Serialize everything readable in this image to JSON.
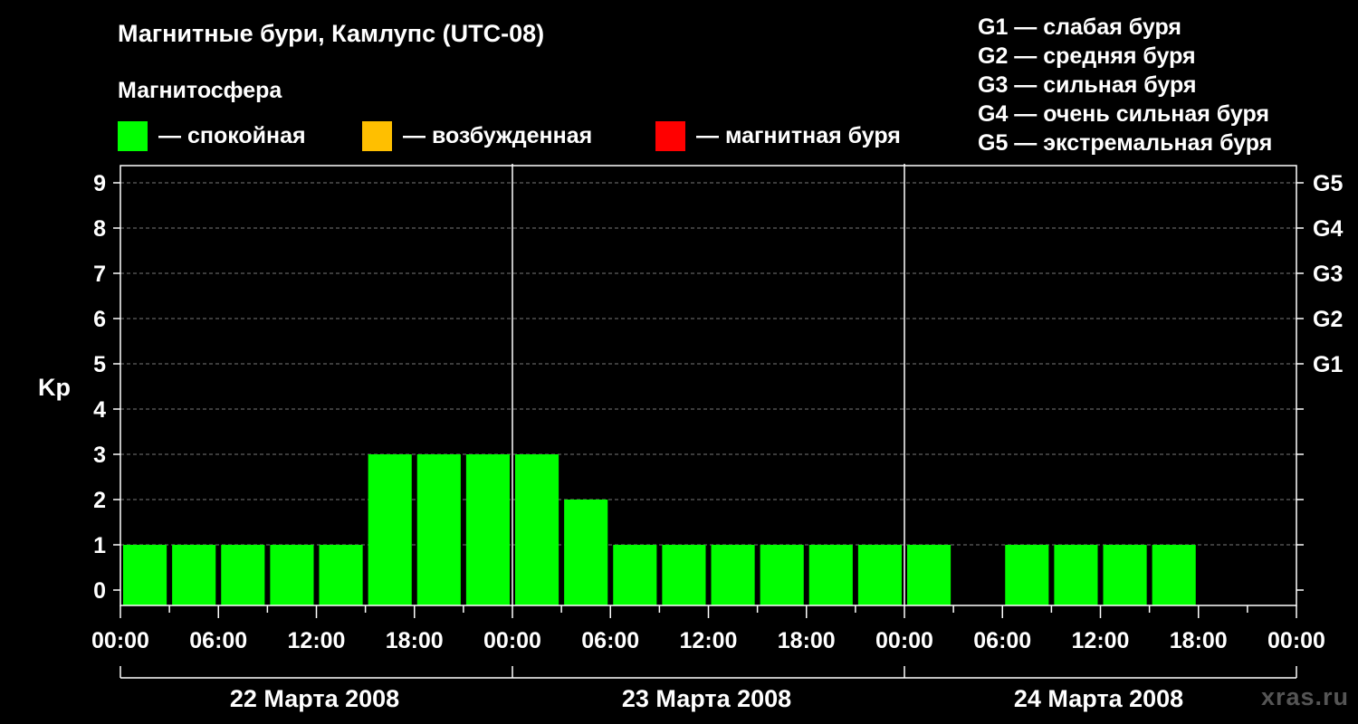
{
  "page": {
    "title": "Магнитные бури, Камлупс (UTC-08)",
    "subtitle": "Магнитосфера",
    "legend": [
      {
        "label": "— спокойная",
        "color": "#00ff00"
      },
      {
        "label": "— возбужденная",
        "color": "#ffbf00"
      },
      {
        "label": "— магнитная буря",
        "color": "#ff0000"
      }
    ],
    "g_scale": [
      "G1 — слабая буря",
      "G2 — средняя буря",
      "G3 — сильная буря",
      "G4 — очень сильная буря",
      "G5 — экстремальная буря"
    ],
    "watermark": "xras.ru"
  },
  "chart_data": {
    "type": "bar",
    "ylabel": "Kp",
    "ylim": [
      0,
      9
    ],
    "yticks": [
      "0",
      "1",
      "2",
      "3",
      "4",
      "5",
      "6",
      "7",
      "8",
      "9"
    ],
    "right_ticks": [
      {
        "value": 5,
        "label": "G1"
      },
      {
        "value": 6,
        "label": "G2"
      },
      {
        "value": 7,
        "label": "G3"
      },
      {
        "value": 8,
        "label": "G4"
      },
      {
        "value": 9,
        "label": "G5"
      }
    ],
    "xlim_hours": [
      0,
      72
    ],
    "xtick_labels": [
      "00:00",
      "06:00",
      "12:00",
      "18:00",
      "00:00",
      "06:00",
      "12:00",
      "18:00",
      "00:00",
      "06:00",
      "12:00",
      "18:00",
      "00:00"
    ],
    "days": [
      "22 Марта 2008",
      "23 Марта 2008",
      "24 Марта 2008"
    ],
    "bar_hours": 3,
    "values": [
      1,
      1,
      1,
      1,
      1,
      3,
      3,
      3,
      3,
      2,
      1,
      1,
      1,
      1,
      1,
      1,
      1,
      null,
      1,
      1,
      1,
      1,
      null,
      null
    ],
    "colors": {
      "quiet": "#00ff00",
      "active": "#ffbf00",
      "storm": "#ff0000"
    },
    "grid": "dashed horizontal at integer Kp"
  }
}
